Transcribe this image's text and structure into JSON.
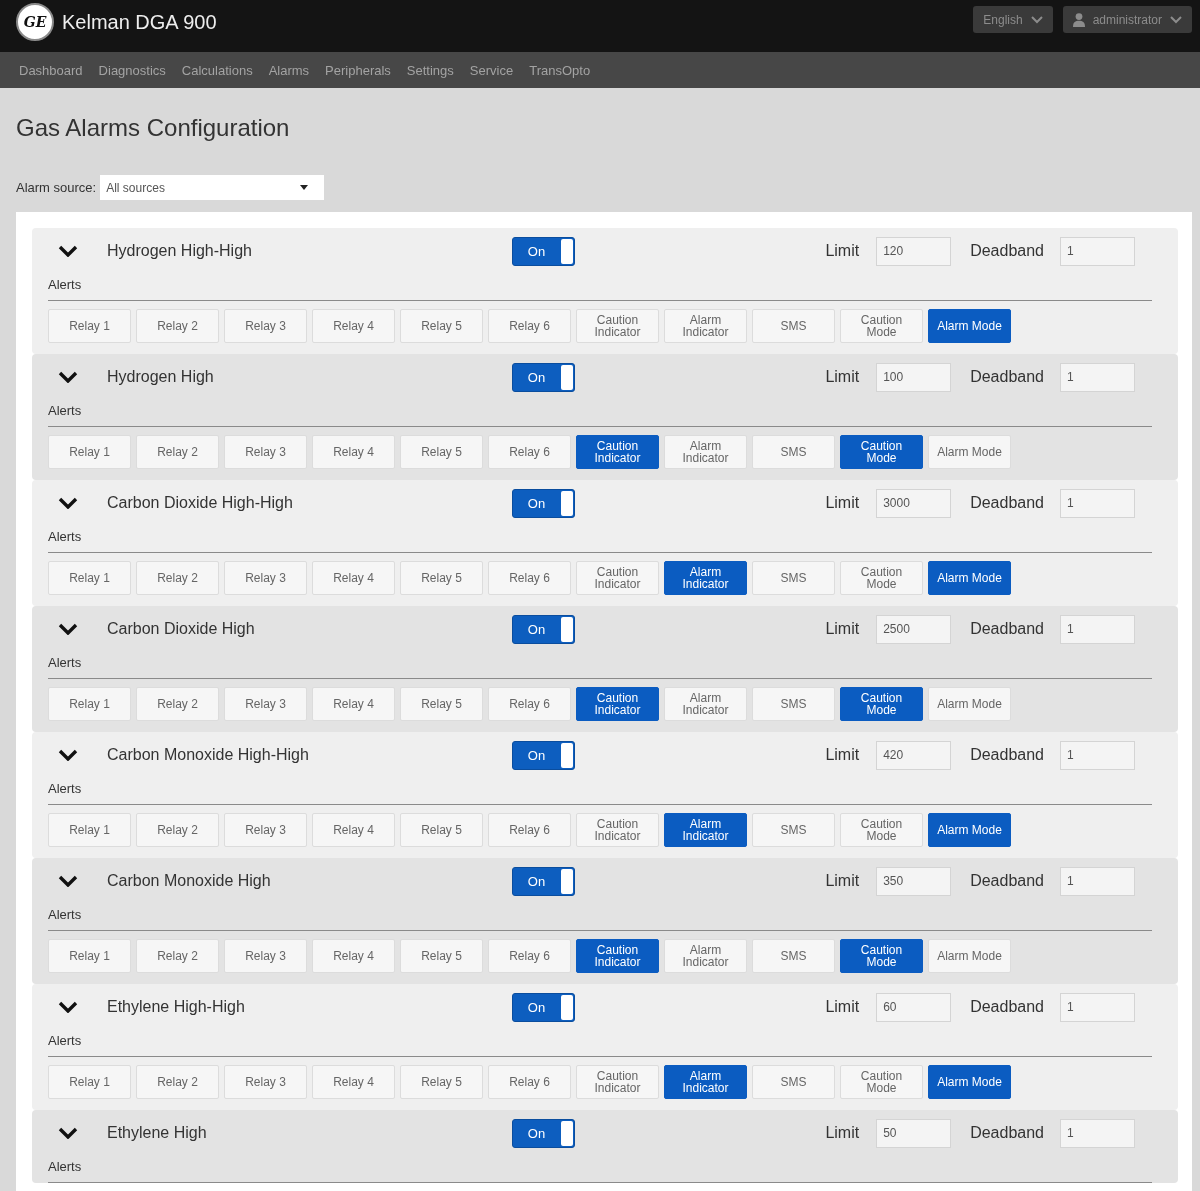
{
  "header": {
    "logo": "GE",
    "title": "Kelman DGA 900",
    "language": "English",
    "user": "administrator"
  },
  "nav": [
    "Dashboard",
    "Diagnostics",
    "Calculations",
    "Alarms",
    "Peripherals",
    "Settings",
    "Service",
    "TransOpto"
  ],
  "page": {
    "title": "Gas Alarms Configuration",
    "source_label": "Alarm source:",
    "source_value": "All sources"
  },
  "alarms": [
    {
      "name": "Hydrogen High-High",
      "expanded": true,
      "toggle": {
        "label": "On",
        "on": true
      },
      "limit_label": "Limit",
      "limit": "120",
      "deadband_label": "Deadband",
      "deadband": "1",
      "alerts_label": "Alerts",
      "alerts": [
        {
          "label": "Relay 1",
          "selected": false
        },
        {
          "label": "Relay 2",
          "selected": false
        },
        {
          "label": "Relay 3",
          "selected": false
        },
        {
          "label": "Relay 4",
          "selected": false
        },
        {
          "label": "Relay 5",
          "selected": false
        },
        {
          "label": "Relay 6",
          "selected": false
        },
        {
          "label": "Caution Indicator",
          "selected": false
        },
        {
          "label": "Alarm Indicator",
          "selected": false
        },
        {
          "label": "SMS",
          "selected": false
        },
        {
          "label": "Caution Mode",
          "selected": false
        },
        {
          "label": "Alarm Mode",
          "selected": true
        }
      ]
    },
    {
      "name": "Hydrogen High",
      "expanded": true,
      "toggle": {
        "label": "On",
        "on": true
      },
      "limit_label": "Limit",
      "limit": "100",
      "deadband_label": "Deadband",
      "deadband": "1",
      "alerts_label": "Alerts",
      "alerts": [
        {
          "label": "Relay 1",
          "selected": false
        },
        {
          "label": "Relay 2",
          "selected": false
        },
        {
          "label": "Relay 3",
          "selected": false
        },
        {
          "label": "Relay 4",
          "selected": false
        },
        {
          "label": "Relay 5",
          "selected": false
        },
        {
          "label": "Relay 6",
          "selected": false
        },
        {
          "label": "Caution Indicator",
          "selected": true
        },
        {
          "label": "Alarm Indicator",
          "selected": false
        },
        {
          "label": "SMS",
          "selected": false
        },
        {
          "label": "Caution Mode",
          "selected": true
        },
        {
          "label": "Alarm Mode",
          "selected": false
        }
      ]
    },
    {
      "name": "Carbon Dioxide High-High",
      "expanded": true,
      "toggle": {
        "label": "On",
        "on": true
      },
      "limit_label": "Limit",
      "limit": "3000",
      "deadband_label": "Deadband",
      "deadband": "1",
      "alerts_label": "Alerts",
      "alerts": [
        {
          "label": "Relay 1",
          "selected": false
        },
        {
          "label": "Relay 2",
          "selected": false
        },
        {
          "label": "Relay 3",
          "selected": false
        },
        {
          "label": "Relay 4",
          "selected": false
        },
        {
          "label": "Relay 5",
          "selected": false
        },
        {
          "label": "Relay 6",
          "selected": false
        },
        {
          "label": "Caution Indicator",
          "selected": false
        },
        {
          "label": "Alarm Indicator",
          "selected": true
        },
        {
          "label": "SMS",
          "selected": false
        },
        {
          "label": "Caution Mode",
          "selected": false
        },
        {
          "label": "Alarm Mode",
          "selected": true
        }
      ]
    },
    {
      "name": "Carbon Dioxide High",
      "expanded": true,
      "toggle": {
        "label": "On",
        "on": true
      },
      "limit_label": "Limit",
      "limit": "2500",
      "deadband_label": "Deadband",
      "deadband": "1",
      "alerts_label": "Alerts",
      "alerts": [
        {
          "label": "Relay 1",
          "selected": false
        },
        {
          "label": "Relay 2",
          "selected": false
        },
        {
          "label": "Relay 3",
          "selected": false
        },
        {
          "label": "Relay 4",
          "selected": false
        },
        {
          "label": "Relay 5",
          "selected": false
        },
        {
          "label": "Relay 6",
          "selected": false
        },
        {
          "label": "Caution Indicator",
          "selected": true
        },
        {
          "label": "Alarm Indicator",
          "selected": false
        },
        {
          "label": "SMS",
          "selected": false
        },
        {
          "label": "Caution Mode",
          "selected": true
        },
        {
          "label": "Alarm Mode",
          "selected": false
        }
      ]
    },
    {
      "name": "Carbon Monoxide High-High",
      "expanded": true,
      "toggle": {
        "label": "On",
        "on": true
      },
      "limit_label": "Limit",
      "limit": "420",
      "deadband_label": "Deadband",
      "deadband": "1",
      "alerts_label": "Alerts",
      "alerts": [
        {
          "label": "Relay 1",
          "selected": false
        },
        {
          "label": "Relay 2",
          "selected": false
        },
        {
          "label": "Relay 3",
          "selected": false
        },
        {
          "label": "Relay 4",
          "selected": false
        },
        {
          "label": "Relay 5",
          "selected": false
        },
        {
          "label": "Relay 6",
          "selected": false
        },
        {
          "label": "Caution Indicator",
          "selected": false
        },
        {
          "label": "Alarm Indicator",
          "selected": true
        },
        {
          "label": "SMS",
          "selected": false
        },
        {
          "label": "Caution Mode",
          "selected": false
        },
        {
          "label": "Alarm Mode",
          "selected": true
        }
      ]
    },
    {
      "name": "Carbon Monoxide High",
      "expanded": true,
      "toggle": {
        "label": "On",
        "on": true
      },
      "limit_label": "Limit",
      "limit": "350",
      "deadband_label": "Deadband",
      "deadband": "1",
      "alerts_label": "Alerts",
      "alerts": [
        {
          "label": "Relay 1",
          "selected": false
        },
        {
          "label": "Relay 2",
          "selected": false
        },
        {
          "label": "Relay 3",
          "selected": false
        },
        {
          "label": "Relay 4",
          "selected": false
        },
        {
          "label": "Relay 5",
          "selected": false
        },
        {
          "label": "Relay 6",
          "selected": false
        },
        {
          "label": "Caution Indicator",
          "selected": true
        },
        {
          "label": "Alarm Indicator",
          "selected": false
        },
        {
          "label": "SMS",
          "selected": false
        },
        {
          "label": "Caution Mode",
          "selected": true
        },
        {
          "label": "Alarm Mode",
          "selected": false
        }
      ]
    },
    {
      "name": "Ethylene High-High",
      "expanded": true,
      "toggle": {
        "label": "On",
        "on": true
      },
      "limit_label": "Limit",
      "limit": "60",
      "deadband_label": "Deadband",
      "deadband": "1",
      "alerts_label": "Alerts",
      "alerts": [
        {
          "label": "Relay 1",
          "selected": false
        },
        {
          "label": "Relay 2",
          "selected": false
        },
        {
          "label": "Relay 3",
          "selected": false
        },
        {
          "label": "Relay 4",
          "selected": false
        },
        {
          "label": "Relay 5",
          "selected": false
        },
        {
          "label": "Relay 6",
          "selected": false
        },
        {
          "label": "Caution Indicator",
          "selected": false
        },
        {
          "label": "Alarm Indicator",
          "selected": true
        },
        {
          "label": "SMS",
          "selected": false
        },
        {
          "label": "Caution Mode",
          "selected": false
        },
        {
          "label": "Alarm Mode",
          "selected": true
        }
      ]
    },
    {
      "name": "Ethylene High",
      "expanded": true,
      "toggle": {
        "label": "On",
        "on": true
      },
      "limit_label": "Limit",
      "limit": "50",
      "deadband_label": "Deadband",
      "deadband": "1",
      "alerts_label": "Alerts"
    }
  ]
}
